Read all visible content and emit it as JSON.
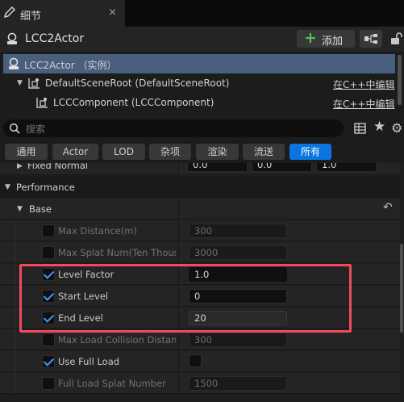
{
  "tab": {
    "title": "细节",
    "close": "×"
  },
  "header": {
    "actor_name": "LCC2Actor",
    "add_label": "添加"
  },
  "tree": {
    "rows": [
      {
        "label": "LCC2Actor （实例）",
        "edit": ""
      },
      {
        "label": "DefaultSceneRoot (DefaultSceneRoot)",
        "edit": "在C++中编辑"
      },
      {
        "label": "LCCComponent (LCCComponent)",
        "edit": "在C++中编辑"
      }
    ]
  },
  "search": {
    "placeholder": "搜索"
  },
  "filters": [
    "通用",
    "Actor",
    "LOD",
    "杂项",
    "渲染",
    "流送",
    "所有"
  ],
  "active_filter": "所有",
  "details": {
    "partial_row": {
      "name": "Fixed Normal",
      "values": [
        "0.0",
        "0.0",
        "1.0"
      ]
    },
    "category": "Performance",
    "subcategory": "Base",
    "properties": [
      {
        "name": "Max Distance(m)",
        "value": "300",
        "checked": false,
        "enabled": false
      },
      {
        "name": "Max Splat Num(Ten Thousand)",
        "value": "3000",
        "checked": false,
        "enabled": false
      },
      {
        "name": "Level Factor",
        "value": "1.0",
        "checked": true,
        "enabled": true
      },
      {
        "name": "Start Level",
        "value": "0",
        "checked": true,
        "enabled": true
      },
      {
        "name": "End Level",
        "value": "20",
        "checked": true,
        "enabled": true
      },
      {
        "name": "Max Load Collision Distance",
        "value": "300",
        "checked": false,
        "enabled": false
      },
      {
        "name": "Use Full Load",
        "value": "",
        "checked": true,
        "enabled": true
      },
      {
        "name": "Full Load Splat Number",
        "value": "1500",
        "checked": false,
        "enabled": false
      }
    ]
  },
  "colors": {
    "accent": "#0a75e0",
    "highlight": "#f04b5d",
    "selection": "#4a5f7d",
    "check": "#3a9bff",
    "add_plus": "#53c24f"
  }
}
